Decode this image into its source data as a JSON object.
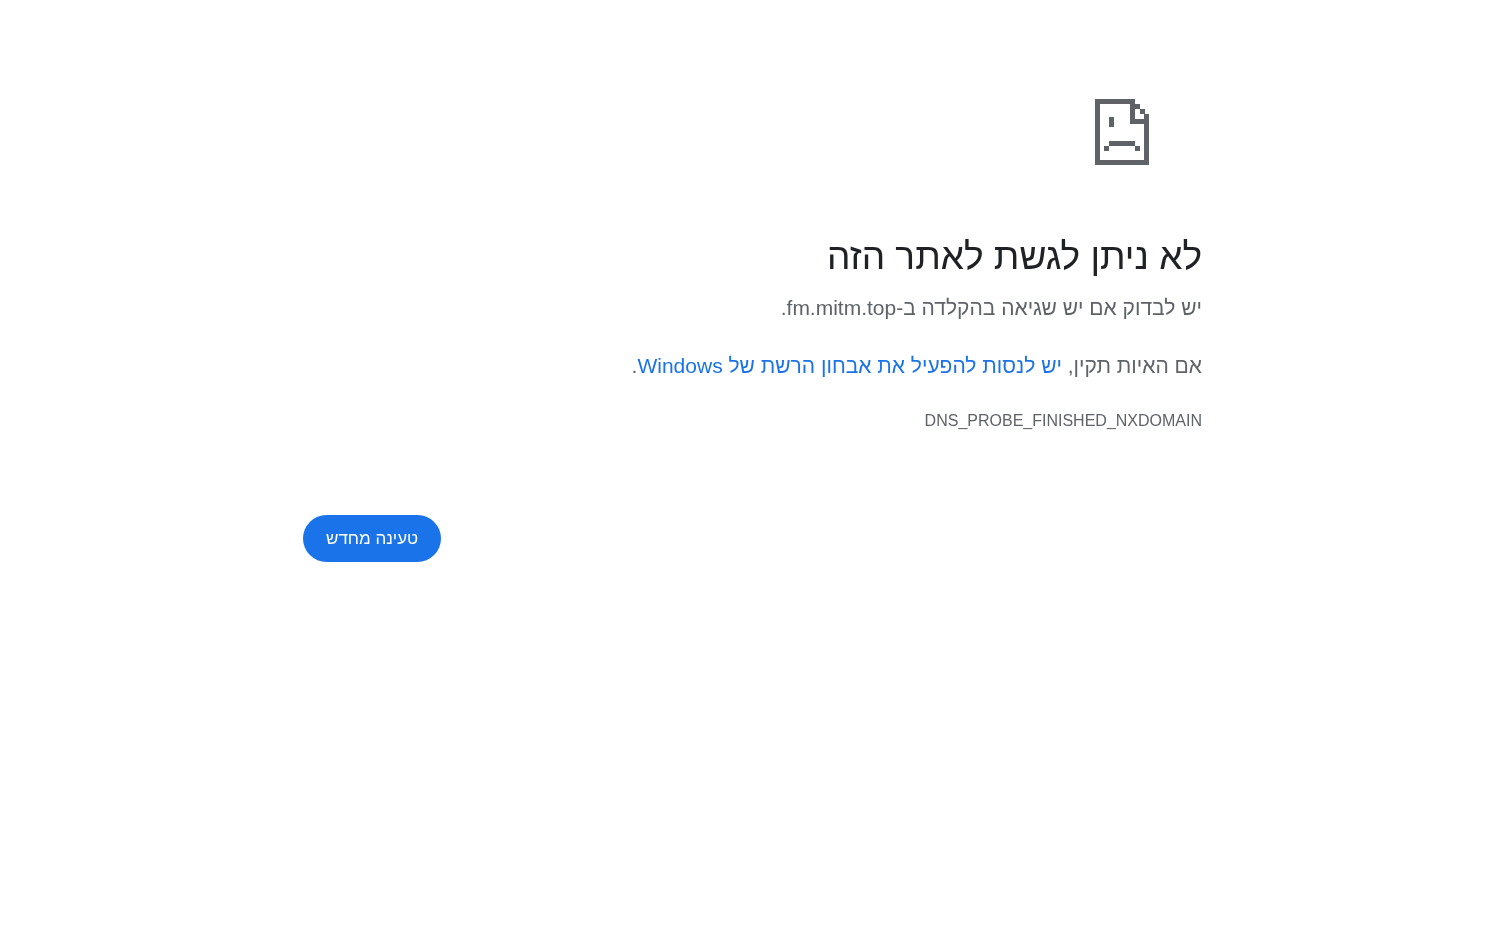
{
  "heading": "לא ניתן לגשת לאתר הזה",
  "check_message": "יש לבדוק אם יש שגיאה בהקלדה ב-fm.mitm.top.",
  "suggestion": {
    "prefix": "אם האיות תקין, ",
    "link": "יש לנסות להפעיל את אבחון הרשת של Windows",
    "suffix": "."
  },
  "error_code": "DNS_PROBE_FINISHED_NXDOMAIN",
  "buttons": [
    {
      "label": "טעינה מחדש",
      "kind": "primary"
    }
  ]
}
